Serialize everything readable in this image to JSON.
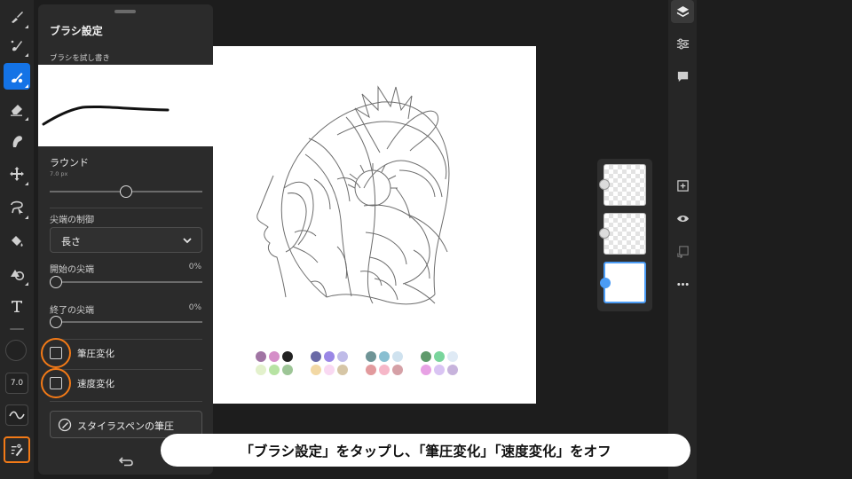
{
  "brush_panel": {
    "title": "ブラシ設定",
    "try_label": "ブラシを試し書き",
    "brush_name": "ラウンド",
    "brush_size_text": "7.0 px",
    "brush_size_slider_level": 0.5,
    "taper_control_label": "尖端の制御",
    "taper_control_value": "長さ",
    "start_taper_label": "開始の尖端",
    "start_taper_value": "0%",
    "end_taper_label": "終了の尖端",
    "end_taper_value": "0%",
    "pressure_label": "筆圧変化",
    "pressure_checked": false,
    "velocity_label": "速度変化",
    "velocity_checked": false,
    "stylus_button_label": "スタイラスペンの筆圧"
  },
  "toolbar": {
    "size_value": "7.0",
    "icons": [
      "brush-icon",
      "smudge-brush-icon",
      "paint-brush-icon",
      "eraser-icon",
      "liquify-icon",
      "transform-icon",
      "lasso-icon",
      "fill-icon",
      "shape-icon",
      "text-icon"
    ],
    "active_tool": "paint-brush-icon",
    "accent_color": "#1473e6",
    "highlight_color": "#f37a17"
  },
  "right_toolbar": {
    "icons": [
      "layers-icon",
      "layer-properties-icon",
      "comments-icon",
      "add-layer-icon",
      "visibility-icon",
      "merge-down-icon",
      "more-icon"
    ]
  },
  "swatches": [
    [
      "#a074a3",
      "#d58ec8",
      "#222222",
      "#e3f1cc",
      "#b7e3a3",
      "#9dc596"
    ],
    [
      "#6a6aa6",
      "#9a87e6",
      "#bfbbe8",
      "#f2d8a4",
      "#f9d9f2",
      "#d6c6a6"
    ],
    [
      "#6e9496",
      "#89bfd1",
      "#cfe2ef",
      "#e29a9d",
      "#f6b7c8",
      "#d5a0a6"
    ],
    [
      "#5f9a6b",
      "#79d59c",
      "#dfeaf5",
      "#e7a1e4",
      "#d9c4f3",
      "#c7b3dc"
    ]
  ],
  "caption": "「ブラシ設定」をタップし、「筆圧変化」「速度変化」をオフ"
}
